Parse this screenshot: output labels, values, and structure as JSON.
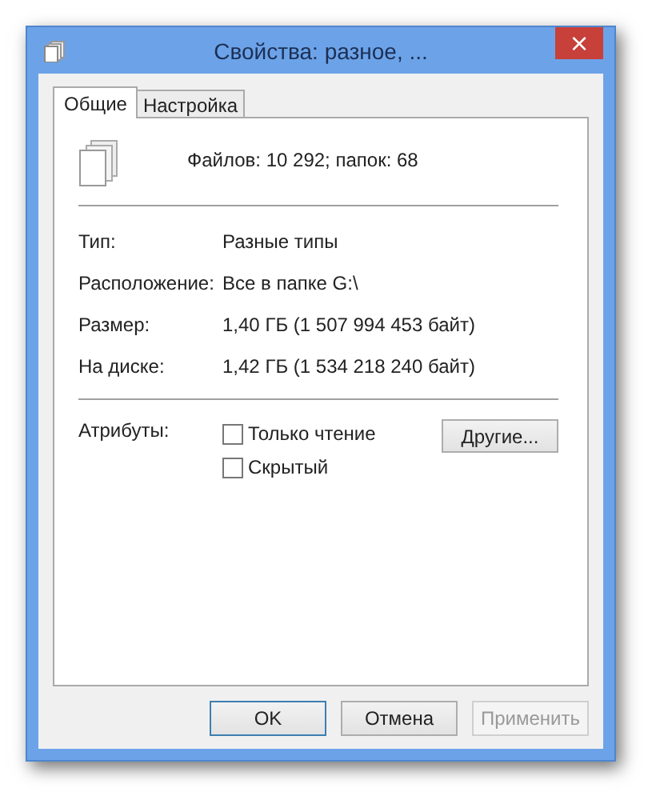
{
  "window": {
    "title": "Свойства: разное, ...",
    "close": "×"
  },
  "tabs": [
    {
      "label": "Общие",
      "selected": true
    },
    {
      "label": "Настройка",
      "selected": false
    }
  ],
  "summary": "Файлов: 10 292; папок: 68",
  "properties": [
    {
      "label": "Тип:",
      "value": "Разные типы"
    },
    {
      "label": "Расположение:",
      "value": "Все в папке G:\\"
    },
    {
      "label": "Размер:",
      "value": "1,40 ГБ (1 507 994 453 байт)"
    },
    {
      "label": "На диске:",
      "value": "1,42 ГБ (1 534 218 240 байт)"
    }
  ],
  "attributes": {
    "label": "Атрибуты:",
    "checkboxes": [
      {
        "label": "Только чтение",
        "checked": false
      },
      {
        "label": "Скрытый",
        "checked": false
      }
    ],
    "more_button": "Другие..."
  },
  "buttons": [
    {
      "label": "OK",
      "default": true,
      "disabled": false
    },
    {
      "label": "Отмена",
      "default": false,
      "disabled": false
    },
    {
      "label": "Применить",
      "default": false,
      "disabled": true
    }
  ]
}
